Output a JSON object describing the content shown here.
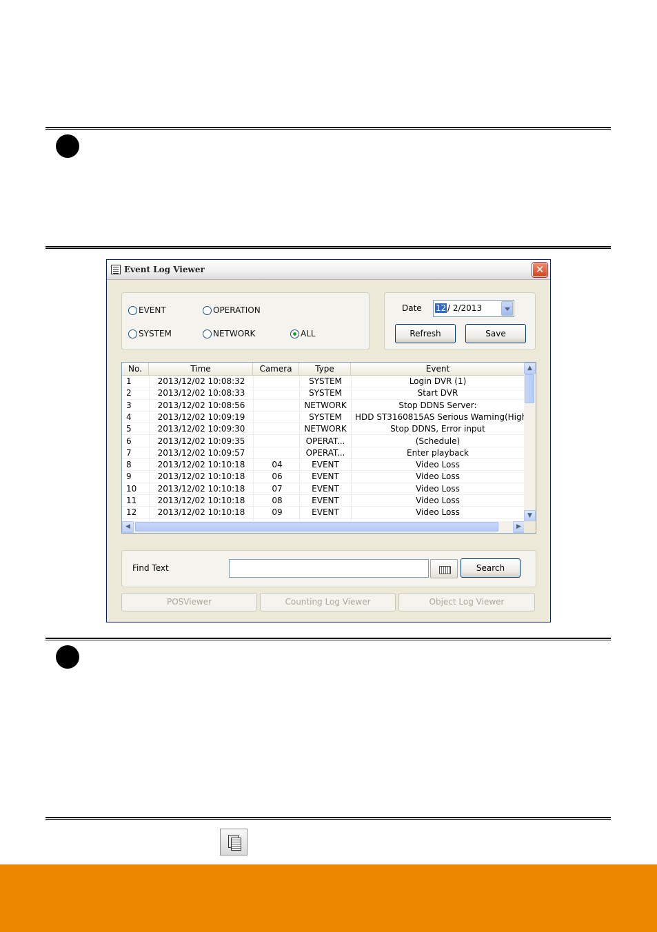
{
  "window": {
    "title": "Event Log Viewer",
    "close_label": "✕"
  },
  "filters": {
    "event": "EVENT",
    "operation": "OPERATION",
    "system": "SYSTEM",
    "network": "NETWORK",
    "all": "ALL",
    "selected": "ALL"
  },
  "date": {
    "label": "Date",
    "month": "12",
    "rest": "/ 2/2013"
  },
  "buttons": {
    "refresh": "Refresh",
    "save": "Save",
    "search": "Search",
    "pos_viewer": "POSViewer",
    "counting_log_viewer": "Counting Log Viewer",
    "object_log_viewer": "Object Log Viewer"
  },
  "table": {
    "headers": {
      "no": "No.",
      "time": "Time",
      "camera": "Camera",
      "type": "Type",
      "event": "Event"
    },
    "rows": [
      {
        "no": "1",
        "time": "2013/12/02 10:08:32",
        "camera": "",
        "type": "SYSTEM",
        "event": "Login DVR (1)"
      },
      {
        "no": "2",
        "time": "2013/12/02 10:08:33",
        "camera": "",
        "type": "SYSTEM",
        "event": "Start DVR"
      },
      {
        "no": "3",
        "time": "2013/12/02 10:08:56",
        "camera": "",
        "type": "NETWORK",
        "event": "Stop DDNS Server:"
      },
      {
        "no": "4",
        "time": "2013/12/02 10:09:19",
        "camera": "",
        "type": "SYSTEM",
        "event": "HDD ST3160815AS Serious Warning(High"
      },
      {
        "no": "5",
        "time": "2013/12/02 10:09:30",
        "camera": "",
        "type": "NETWORK",
        "event": "Stop DDNS, Error input"
      },
      {
        "no": "6",
        "time": "2013/12/02 10:09:35",
        "camera": "",
        "type": "OPERAT...",
        "event": "(Schedule)"
      },
      {
        "no": "7",
        "time": "2013/12/02 10:09:57",
        "camera": "",
        "type": "OPERAT...",
        "event": "Enter playback"
      },
      {
        "no": "8",
        "time": "2013/12/02 10:10:18",
        "camera": "04",
        "type": "EVENT",
        "event": "Video Loss"
      },
      {
        "no": "9",
        "time": "2013/12/02 10:10:18",
        "camera": "06",
        "type": "EVENT",
        "event": "Video Loss"
      },
      {
        "no": "10",
        "time": "2013/12/02 10:10:18",
        "camera": "07",
        "type": "EVENT",
        "event": "Video Loss"
      },
      {
        "no": "11",
        "time": "2013/12/02 10:10:18",
        "camera": "08",
        "type": "EVENT",
        "event": "Video Loss"
      },
      {
        "no": "12",
        "time": "2013/12/02 10:10:18",
        "camera": "09",
        "type": "EVENT",
        "event": "Video Loss"
      }
    ]
  },
  "find": {
    "label": "Find Text",
    "value": ""
  },
  "colors": {
    "accent_orange": "#ee8700",
    "title_close_red": "#d3431e",
    "selection_blue": "#316ac5"
  },
  "icons": {
    "title": "log-list-icon",
    "keyboard": "keyboard-icon",
    "footer": "copy-document-icon"
  }
}
